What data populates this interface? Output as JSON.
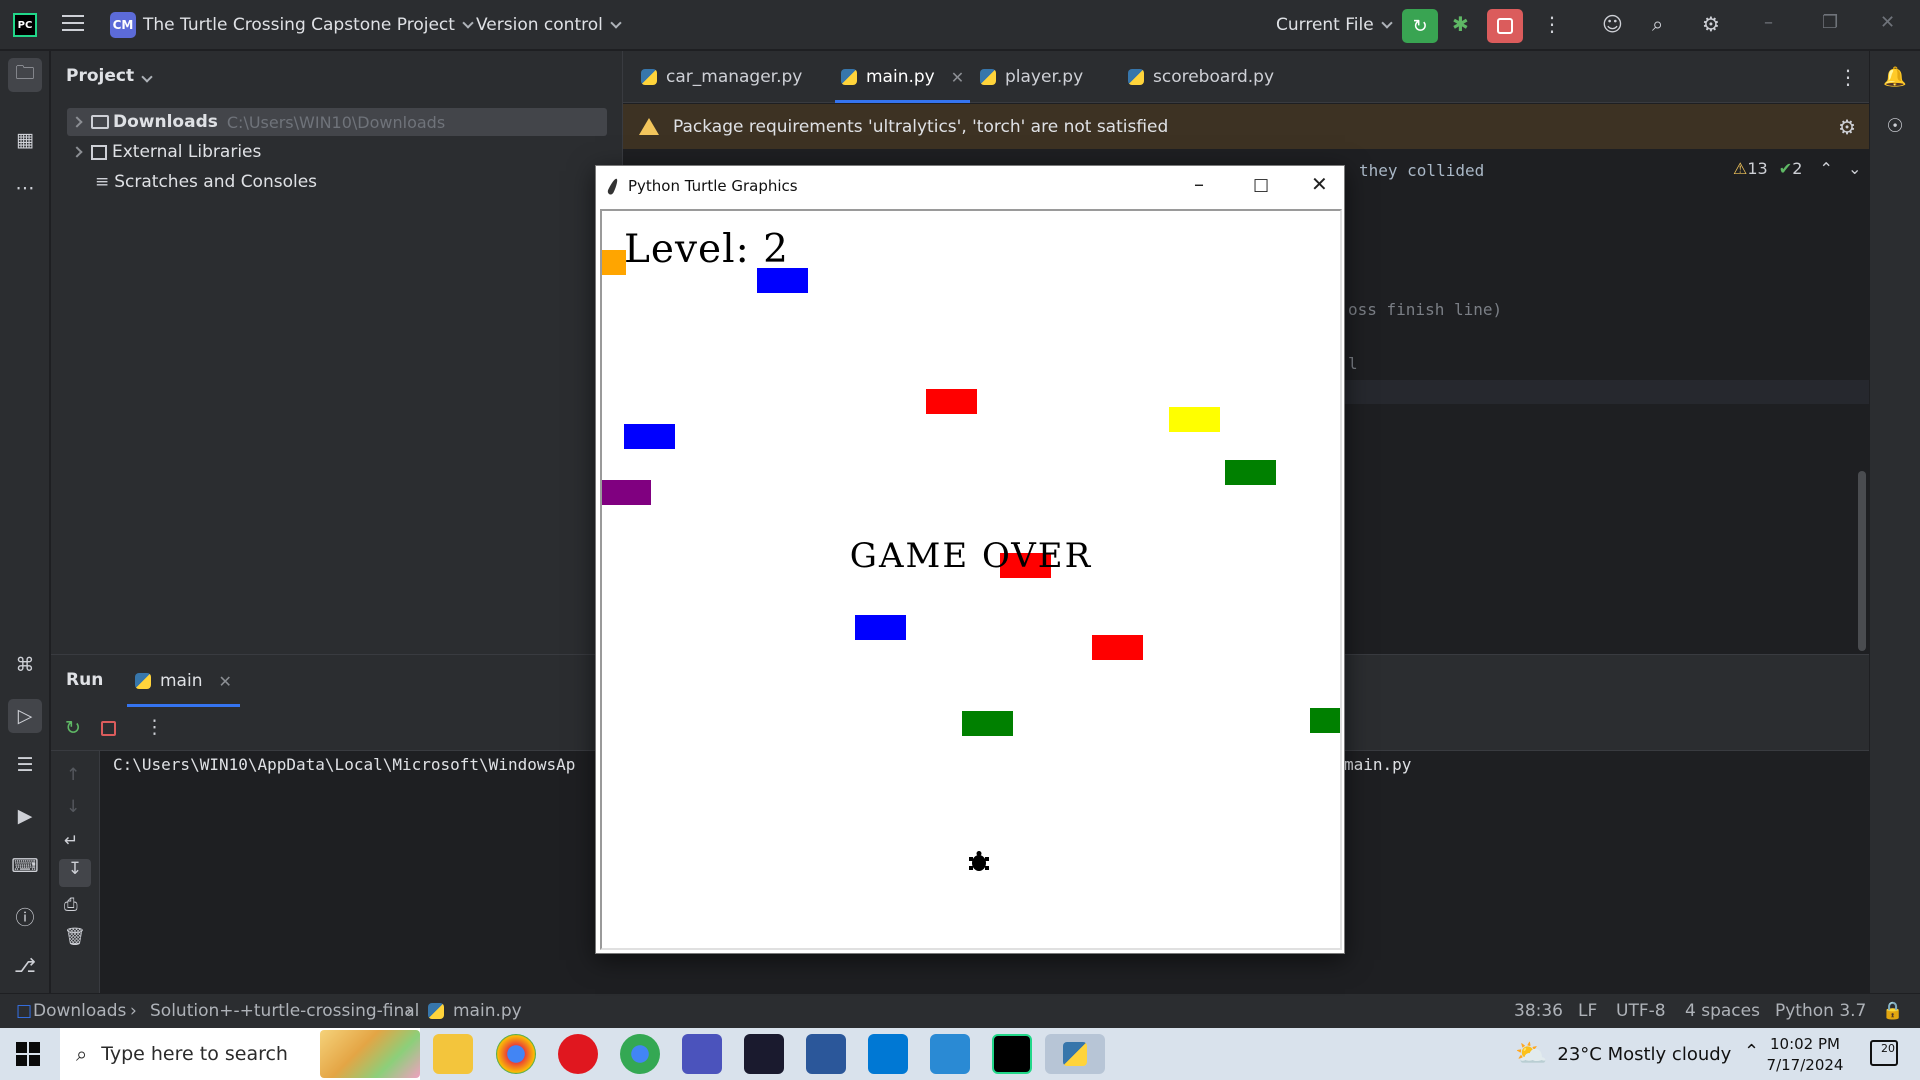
{
  "titlebar": {
    "logo": "PC",
    "project_badge": "CM",
    "project_name": "The Turtle Crossing Capstone Project",
    "vcs_label": "Version control",
    "run_config": "Current File"
  },
  "project_panel": {
    "title": "Project",
    "items": [
      {
        "label": "Downloads",
        "path": "C:\\Users\\WIN10\\Downloads"
      },
      {
        "label": "External Libraries"
      },
      {
        "label": "Scratches and Consoles"
      }
    ]
  },
  "editor": {
    "tabs": [
      {
        "label": "car_manager.py"
      },
      {
        "label": "main.py"
      },
      {
        "label": "player.py"
      },
      {
        "label": "scoreboard.py"
      }
    ],
    "warning": "Package requirements 'ultralytics', 'torch' are not satisfied",
    "code_fragments": [
      "they collided",
      "oss finish line)",
      "l"
    ],
    "inspections": {
      "warnings": "13",
      "typos": "2"
    }
  },
  "run_panel": {
    "title": "Run",
    "tab": "main",
    "console_left": "C:\\Users\\WIN10\\AppData\\Local\\Microsoft\\WindowsAp",
    "console_right": "main.py"
  },
  "statusbar": {
    "breadcrumb": [
      "Downloads",
      "Solution+-+turtle-crossing-final",
      "main.py"
    ],
    "position": "38:36",
    "line_sep": "LF",
    "encoding": "UTF-8",
    "indent": "4 spaces",
    "interpreter": "Python 3.7"
  },
  "turtle_window": {
    "title": "Python Turtle Graphics",
    "level_text": "Level: 2",
    "game_over": "GAME OVER",
    "cars": [
      {
        "color": "#ffa500"
      },
      {
        "color": "#0000ff"
      },
      {
        "color": "#ff0000"
      },
      {
        "color": "#ffff00"
      },
      {
        "color": "#0000ff"
      },
      {
        "color": "#008000"
      },
      {
        "color": "#800080"
      },
      {
        "color": "#ff0000"
      },
      {
        "color": "#0000ff"
      },
      {
        "color": "#ff0000"
      },
      {
        "color": "#008000"
      },
      {
        "color": "#008000"
      }
    ]
  },
  "taskbar": {
    "search_placeholder": "Type here to search",
    "weather": "23°C  Mostly cloudy",
    "time": "10:02 PM",
    "date": "7/17/2024",
    "notifications": "20"
  }
}
